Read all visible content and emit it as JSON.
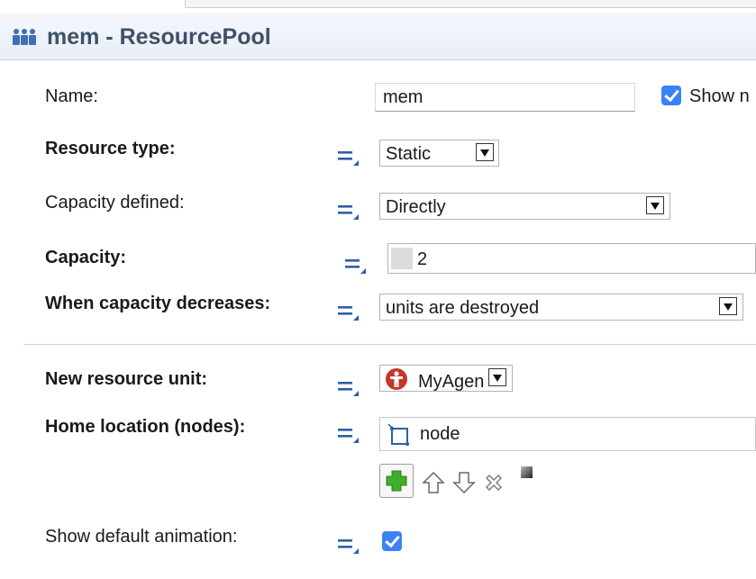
{
  "header": {
    "title": "mem - ResourcePool",
    "icon": "resource-pool-icon"
  },
  "fields": {
    "name": {
      "label": "Name:",
      "value": "mem",
      "show_name_label": "Show n",
      "show_name_checked": true
    },
    "resource_type": {
      "label": "Resource type:",
      "value": "Static"
    },
    "capacity_defined": {
      "label": "Capacity defined:",
      "value": "Directly"
    },
    "capacity": {
      "label": "Capacity:",
      "value": "2"
    },
    "when_capacity_decreases": {
      "label": "When capacity decreases:",
      "value": "units are destroyed"
    },
    "new_resource_unit": {
      "label": "New resource unit:",
      "value": "MyAgen"
    },
    "home_location": {
      "label": "Home location (nodes):",
      "value": "node"
    },
    "show_default_animation": {
      "label": "Show default animation:",
      "checked": true
    }
  },
  "toolbar": {
    "add": "plus-icon",
    "move_up": "arrow-up-icon",
    "move_down": "arrow-down-icon",
    "remove": "close-icon"
  },
  "colors": {
    "accent": "#3b82f6",
    "title": "#3f5068",
    "agent_red": "#c0392b",
    "add_green": "#3fae2a"
  }
}
